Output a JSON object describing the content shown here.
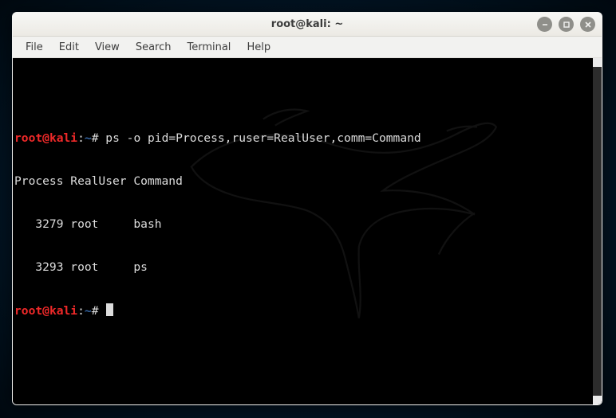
{
  "titlebar": {
    "title": "root@kali: ~"
  },
  "menubar": {
    "items": [
      "File",
      "Edit",
      "View",
      "Search",
      "Terminal",
      "Help"
    ]
  },
  "prompt": {
    "user": "root",
    "at": "@",
    "host": "kali",
    "sep": ":",
    "path": "~",
    "hash": "#"
  },
  "terminal": {
    "command1": "ps -o pid=Process,ruser=RealUser,comm=Command",
    "output_header": "Process RealUser Command",
    "rows": [
      {
        "pid": "   3279",
        "user": " root    ",
        "cmd": " bash"
      },
      {
        "pid": "   3293",
        "user": " root    ",
        "cmd": " ps"
      }
    ]
  }
}
